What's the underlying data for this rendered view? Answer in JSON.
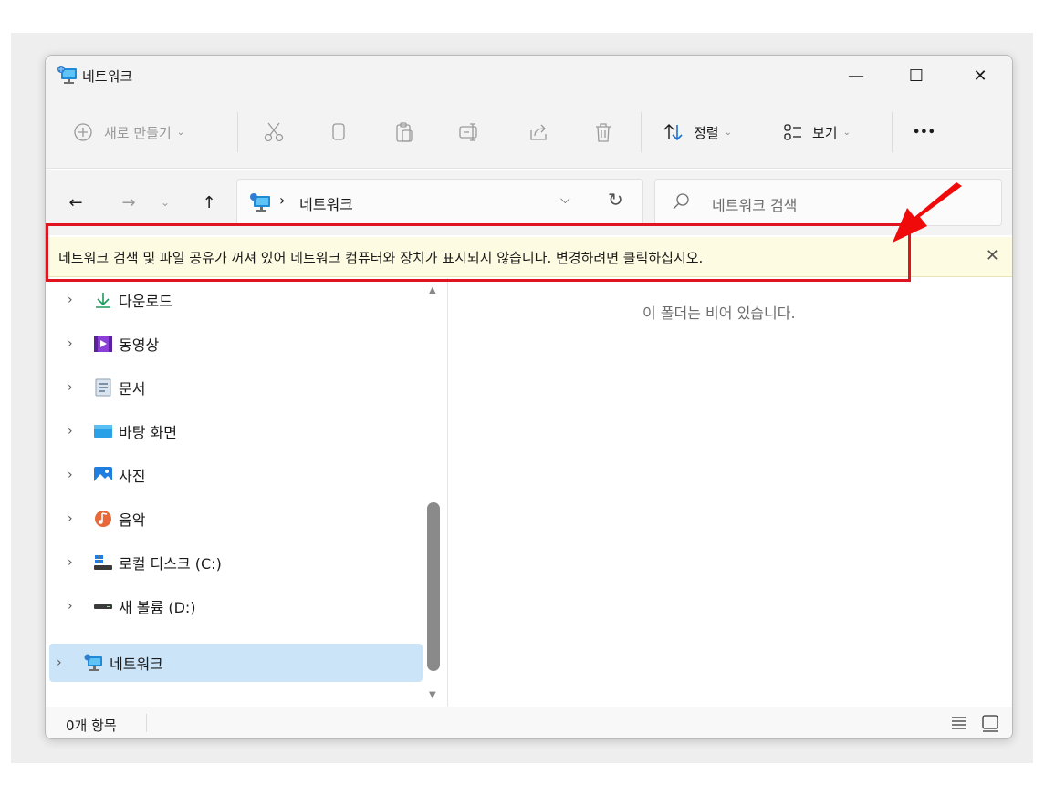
{
  "window": {
    "title": "네트워크",
    "minimize_label": "—",
    "maximize_label": "☐",
    "close_label": "✕"
  },
  "toolbar": {
    "new_label": "새로 만들기",
    "sort_label": "정렬",
    "view_label": "보기",
    "more_label": "•••"
  },
  "address": {
    "path": "네트워크",
    "separator": "›",
    "search_placeholder": "네트워크 검색"
  },
  "infobar": {
    "message": "네트워크 검색 및 파일 공유가 꺼져 있어 네트워크 컴퓨터와 장치가 표시되지 않습니다. 변경하려면 클릭하십시오.",
    "close_label": "✕"
  },
  "nav": {
    "items": [
      {
        "label": "다운로드",
        "icon": "download-icon"
      },
      {
        "label": "동영상",
        "icon": "videos-icon"
      },
      {
        "label": "문서",
        "icon": "documents-icon"
      },
      {
        "label": "바탕 화면",
        "icon": "desktop-icon"
      },
      {
        "label": "사진",
        "icon": "pictures-icon"
      },
      {
        "label": "음악",
        "icon": "music-icon"
      },
      {
        "label": "로컬 디스크 (C:)",
        "icon": "local-disk-icon"
      },
      {
        "label": "새 볼륨 (D:)",
        "icon": "drive-icon"
      },
      {
        "label": "네트워크",
        "icon": "network-icon",
        "selected": true
      }
    ]
  },
  "content": {
    "empty_message": "이 폴더는 비어 있습니다."
  },
  "status": {
    "item_count": "0개 항목"
  },
  "colors": {
    "highlight_border": "#e0141e",
    "arrow": "#f00a0a",
    "selection": "#cce4f7",
    "infobar_bg": "#fdfbe2"
  }
}
